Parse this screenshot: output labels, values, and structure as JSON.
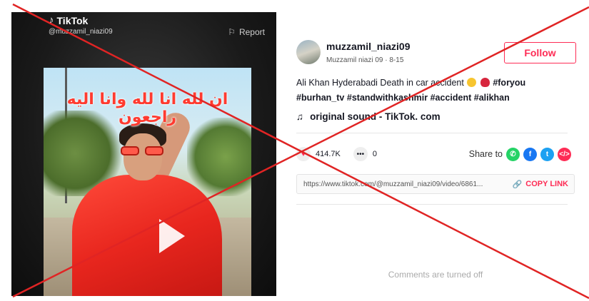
{
  "video": {
    "app_name": "TikTok",
    "handle": "@muzzamil_niazi09",
    "report_label": "Report",
    "overlay_text": "ان لله انا لله وانا اليه راجعون"
  },
  "author": {
    "username": "muzzamil_niazi09",
    "subline": "Muzzamil niazi 09 · 8-15",
    "follow_label": "Follow"
  },
  "caption": {
    "text": "Ali Khan Hyderabadi Death in car accident",
    "tag1": "#foryou",
    "tag2": "#burhan_tv",
    "tag3": "#standwithkashmir",
    "tag4": "#accident",
    "tag5": "#alikhan"
  },
  "sound": {
    "label": "original sound - TikTok. com"
  },
  "stats": {
    "likes": "414.7K",
    "comments": "0",
    "share_label": "Share to"
  },
  "share_icons": [
    "whatsapp-icon",
    "facebook-icon",
    "twitter-icon",
    "embed-icon"
  ],
  "link": {
    "url": "https://www.tiktok.com/@muzzamil_niazi09/video/6861...",
    "copy_label": "COPY LINK"
  },
  "comments_status": "Comments are turned off",
  "colors": {
    "accent": "#fe2c55",
    "cross": "#e02424"
  }
}
